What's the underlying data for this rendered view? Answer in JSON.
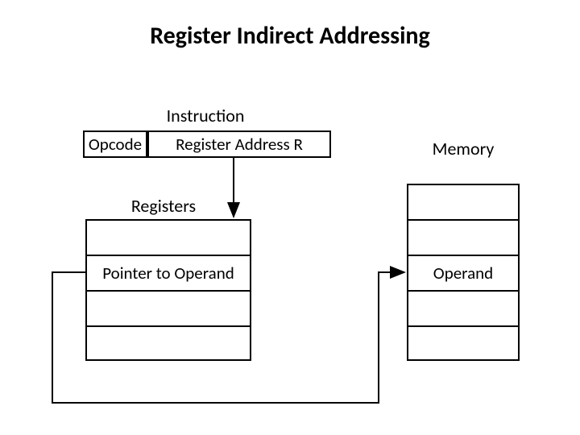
{
  "title": "Register Indirect Addressing",
  "instruction_label": "Instruction",
  "opcode": "Opcode",
  "register_address": "Register Address R",
  "memory_label": "Memory",
  "registers_label": "Registers",
  "register_rows": [
    "",
    "Pointer to Operand",
    "",
    ""
  ],
  "memory_rows": [
    "",
    "",
    "Operand",
    "",
    ""
  ]
}
